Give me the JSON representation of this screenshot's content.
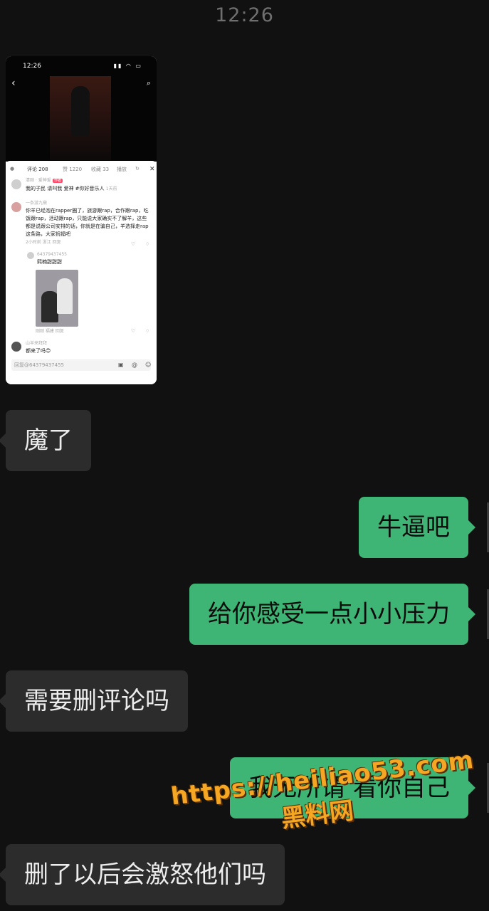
{
  "time": "12:26",
  "shared_screenshot": {
    "status_time": "12:26",
    "tabs": [
      "评论 208",
      "赞 1220",
      "收藏 33",
      "播放"
    ],
    "comments": [
      {
        "user": "清刚 · 爱神爱",
        "badge": "作者",
        "text": "我的子民 请叫我 爱神 #你好音乐人",
        "meta": "1天前"
      },
      {
        "user": "一条游九鼎",
        "text": "你羊已经泡在rapper圈了，旅游跟rap，合作跟rap，吃饭跟rap，活动跟rap，只能说大家确实不了解羊，这些都是说跟公司安排的话，你就是在骗自己，羊选择走rap这条路，大家祝福吧",
        "meta": "2小时前  浙江  回复"
      },
      {
        "user": "64379437455",
        "text": "熙楠甜甜甜",
        "meta": "刚刚  福建  回复"
      },
      {
        "user": "山羊来拜拜",
        "text": "都来了吗😊",
        "meta": ""
      }
    ],
    "reply_placeholder": "回复@64379437455"
  },
  "messages": [
    {
      "side": "left",
      "text": "魔了"
    },
    {
      "side": "right",
      "text": "牛逼吧"
    },
    {
      "side": "right",
      "text": "给你感受一点小小压力"
    },
    {
      "side": "left",
      "text": "需要删评论吗"
    },
    {
      "side": "right",
      "text": "我无所谓 看你自己"
    },
    {
      "side": "left",
      "text": "删了以后会激怒他们吗"
    }
  ],
  "watermark": {
    "url": "https://heiliao53.com",
    "name": "黑料网"
  },
  "colors": {
    "background": "#111111",
    "incoming_bubble": "#2c2c2c",
    "outgoing_bubble": "#3eb575"
  }
}
